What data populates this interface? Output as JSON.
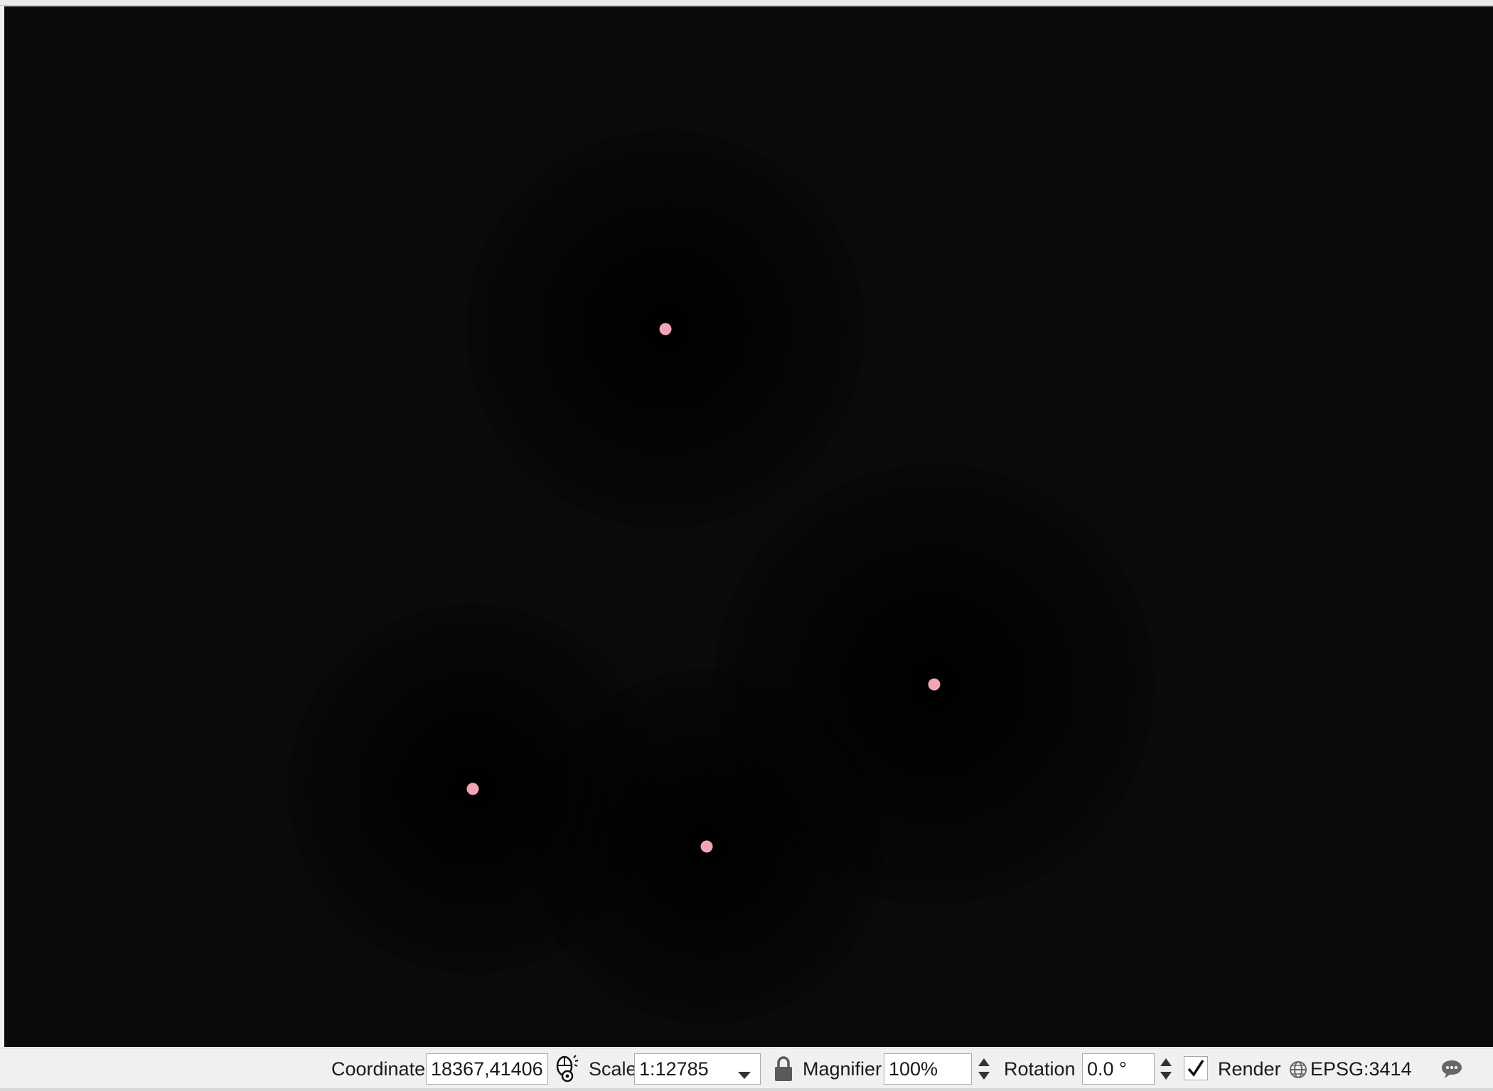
{
  "statusbar": {
    "coordinate_label": "Coordinate",
    "coordinate_value": "18367,41406",
    "scale_label": "Scale",
    "scale_value": "1:12785",
    "magnifier_label": "Magnifier",
    "magnifier_value": "100%",
    "rotation_label": "Rotation",
    "rotation_value": "0.0 °",
    "render_label": "Render",
    "render_checked": true,
    "crs_label": "EPSG:3414"
  },
  "map": {
    "background_color": "#0a0a0a",
    "point_color": "#f2a5b4",
    "point_count": 4
  },
  "icons": {
    "coordinate_toggle": "mouse-pointer-coordinate-icon",
    "scale_dropdown": "chevron-down-icon",
    "scale_lock": "lock-icon",
    "crs": "globe-icon",
    "messages": "speech-bubble-icon"
  }
}
